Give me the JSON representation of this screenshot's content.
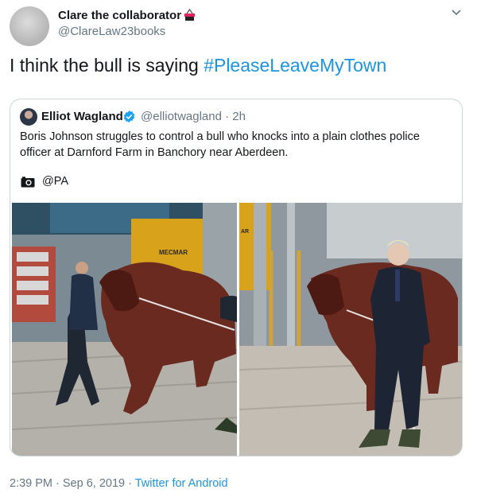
{
  "tweet": {
    "user_name": "Clare the collaborator",
    "user_handle": "@ClareLaw23books",
    "text_prefix": "I think the bull is saying ",
    "hashtag": "#PleaseLeaveMyTown",
    "timestamp": "2:39 PM · Sep 6, 2019 · ",
    "source": "Twitter for Android"
  },
  "quote": {
    "user_name": "Elliot Wagland",
    "user_handle": "@elliotwagland · 2h",
    "text": "Boris Johnson struggles to control a bull who knocks into a plain clothes police officer at Darnford Farm in Banchory near Aberdeen.",
    "credit": "@PA",
    "photo_sign_left": "MECMAR",
    "photo_sign_right": "AR"
  },
  "icons": {
    "name_icon": "shopping-basket-icon",
    "verified": "verified-badge-icon",
    "camera": "camera-icon",
    "chevron": "chevron-down-icon"
  },
  "colors": {
    "link": "#1b95e0",
    "secondary_text": "#657786",
    "border": "#ccd6dd",
    "verified": "#1da1f2"
  }
}
